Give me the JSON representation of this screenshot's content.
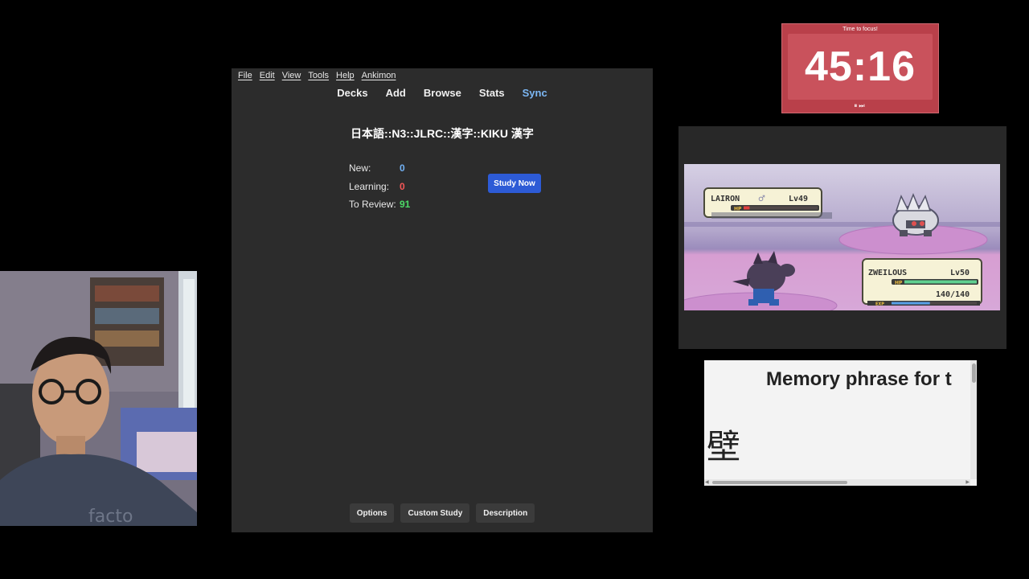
{
  "anki": {
    "menu": [
      "File",
      "Edit",
      "View",
      "Tools",
      "Help",
      "Ankimon"
    ],
    "toolbar": [
      "Decks",
      "Add",
      "Browse",
      "Stats",
      "Sync"
    ],
    "deck_title": "日本語::N3::JLRC::漢字::KIKU 漢字",
    "stats": {
      "new_label": "New:",
      "new_value": "0",
      "learning_label": "Learning:",
      "learning_value": "0",
      "review_label": "To Review:",
      "review_value": "91"
    },
    "study_button": "Study Now",
    "bottom_buttons": {
      "options": "Options",
      "custom_study": "Custom Study",
      "description": "Description"
    },
    "colors": {
      "new": "#72b2f5",
      "learning": "#f55757",
      "review": "#4cd966",
      "study_button": "#2d5bd6"
    }
  },
  "timer": {
    "title": "Time to focus!",
    "time": "45:16",
    "controls": "⏸⏭",
    "color": "#b9404a"
  },
  "game": {
    "enemy": {
      "name": "LAIRON",
      "gender": "♂",
      "level": "Lv49",
      "hp_label": "HP",
      "hp_fraction": 0.08
    },
    "player": {
      "name": "ZWEILOUS",
      "level": "Lv50",
      "hp_label": "HP",
      "hp_text": "140/140",
      "hp_fraction": 1.0,
      "exp_label": "EXP",
      "exp_fraction": 0.45
    }
  },
  "card": {
    "heading": "Memory phrase for t",
    "kanji": "壁"
  }
}
